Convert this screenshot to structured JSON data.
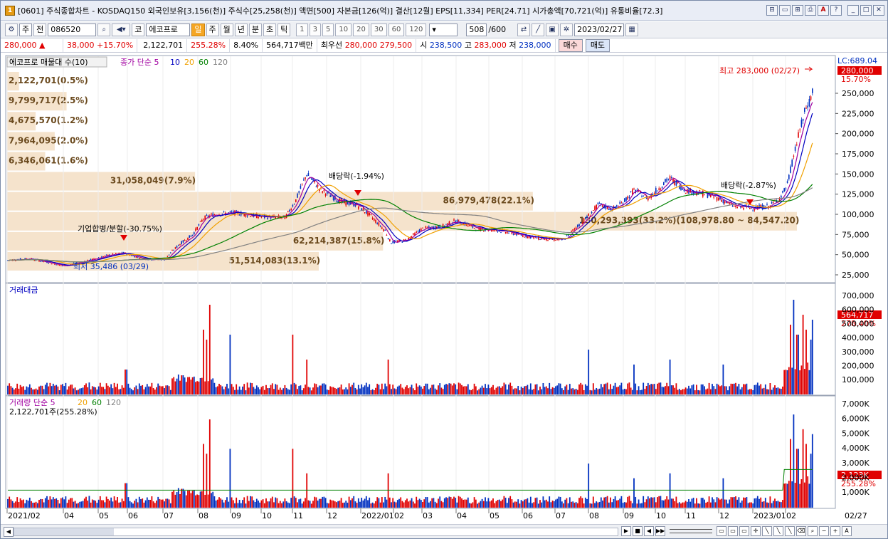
{
  "window": {
    "title": "[0601] 주식종합차트 - KOSDAQ150 외국인보유[3,156(천)] 주식수[25,258(천)] 액면[500] 자본금[126(억)] 결산[12월] EPS[11,334] PER[24.71] 시가총액[70,721(억)] 유통비율[72.3]",
    "buttons": [
      "⊟",
      "▭",
      "⊞",
      "⎙",
      "A",
      "?",
      "_",
      "□",
      "✕"
    ]
  },
  "toolbar": {
    "market": "주",
    "prev_label": "전",
    "code": "086520",
    "market_tag": "코",
    "stock_name": "에코프로",
    "periods": [
      "일",
      "주",
      "월",
      "년",
      "분",
      "초",
      "틱"
    ],
    "active_period": "일",
    "intervals": [
      "1",
      "3",
      "5",
      "10",
      "20",
      "30",
      "60",
      "120"
    ],
    "count": "508",
    "count_total": "/600",
    "date": "2023/02/27"
  },
  "info": {
    "price": "280,000",
    "change": "38,000",
    "change_pct": "+15.70%",
    "volume": "2,122,701",
    "vol_ratio": "255.28%",
    "turnover": "8.40%",
    "amount": "564,717백만",
    "best_quote_label": "최우선",
    "ask": "280,000",
    "bid": "279,500",
    "open_label": "시",
    "open": "238,500",
    "high_label": "고",
    "high": "283,000",
    "low_label": "저",
    "low": "238,000",
    "buy_label": "매수",
    "sell_label": "매도"
  },
  "price_panel": {
    "title": "에코프로 매물대 수(10)",
    "ma_label": "종가 단순 5",
    "ma_periods": [
      "10",
      "20",
      "60",
      "120"
    ],
    "lc": "LC:689.04",
    "last_price": "280,000",
    "last_pct": "15.70%",
    "high_note": "최고 283,000 (02/27)",
    "low_note": "최저 35,486 (03/29)",
    "event_split": "기업합병/분할(-30.75%)",
    "event_div1": "배당락(-1.94%)",
    "event_div2": "배당락(-2.87%)",
    "volume_profile": [
      {
        "label": "2,122,701(0.5%)",
        "frac": 0.005
      },
      {
        "label": "9,799,717(2.5%)",
        "frac": 0.025
      },
      {
        "label": "4,675,570(1.2%)",
        "frac": 0.012
      },
      {
        "label": "7,964,095(2.0%)",
        "frac": 0.02
      },
      {
        "label": "6,346,061(1.6%)",
        "frac": 0.016
      },
      {
        "label": "31,058,049(7.9%)",
        "frac": 0.079
      },
      {
        "label": "86,979,478(22.1%)",
        "frac": 0.221
      },
      {
        "label": "130,293,393(33.2%)(108,978.80 ~ 84,547.20)",
        "frac": 0.332
      },
      {
        "label": "62,214,387(15.8%)",
        "frac": 0.158
      },
      {
        "label": "51,514,083(13.1%)",
        "frac": 0.131
      }
    ],
    "y_ticks": [
      "250,000",
      "225,000",
      "200,000",
      "175,000",
      "150,000",
      "125,000",
      "100,000",
      "75,000",
      "50,000",
      "25,000"
    ]
  },
  "amount_panel": {
    "title": "거래대금",
    "last_value": "564,717",
    "last_pct": "278.40%",
    "y_ticks": [
      "700,000",
      "600,000",
      "500,000",
      "400,000",
      "300,000",
      "200,000",
      "100,000"
    ]
  },
  "volume_panel": {
    "title": "거래량 단순 5",
    "ma_periods": [
      "20",
      "60",
      "120"
    ],
    "current": "2,122,701주(255.28%)",
    "last_value": "2,123K",
    "last_pct": "255.28%",
    "y_ticks": [
      "7,000K",
      "6,000K",
      "5,000K",
      "4,000K",
      "3,000K",
      "2,000K",
      "1,000K"
    ]
  },
  "x_axis": [
    "2021/02",
    "04",
    "05",
    "06",
    "07",
    "08",
    "09",
    "10",
    "11",
    "12",
    "2022/01",
    "02",
    "03",
    "04",
    "05",
    "06",
    "07",
    "08",
    "09",
    "10",
    "11",
    "12",
    "2023/01",
    "02"
  ],
  "x_last": "02/27",
  "colors": {
    "up": "#e00000",
    "down": "#0030c0",
    "profile": "#f5e3cc",
    "ma5": "#a000a0",
    "ma10": "#0000c0",
    "ma20": "#f0a000",
    "ma60": "#008000",
    "ma120": "#808080"
  }
}
